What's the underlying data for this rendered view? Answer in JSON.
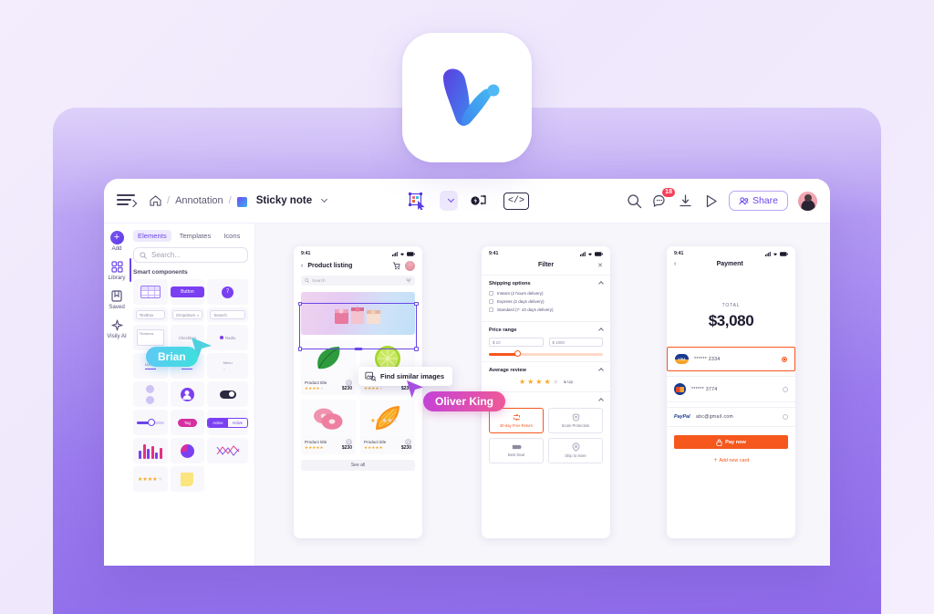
{
  "brand": {
    "name": "Visily",
    "logo_colors": [
      "#5b3fe0",
      "#3fa9f5",
      "#4fc3f7"
    ]
  },
  "theme": {
    "accent": "#6a46e8",
    "orange": "#f5571d",
    "magenta": "#d62fa0",
    "star": "#f9a826"
  },
  "topbar": {
    "menu_icon": "hamburger-icon",
    "breadcrumb": {
      "home_icon": "home-icon",
      "sep1": "/",
      "project": "Annotation",
      "sep2": "/",
      "page": "Sticky note",
      "page_icon": "sticky-note-icon",
      "chevron": "chevron-down-icon"
    },
    "center_tools": [
      {
        "name": "select-frame-tool",
        "icon": "frame-select-icon"
      },
      {
        "name": "tool-options-dropdown",
        "icon": "chevron-down-icon"
      },
      {
        "name": "ai-flow-tool",
        "icon": "ai-flow-icon"
      },
      {
        "name": "code-view-tool",
        "icon": "code-icon",
        "label": "</>"
      }
    ],
    "right_tools": [
      {
        "name": "search-icon",
        "label": ""
      },
      {
        "name": "comments-icon",
        "badge": "18"
      },
      {
        "name": "download-icon",
        "label": ""
      },
      {
        "name": "present-icon",
        "label": ""
      }
    ],
    "share_label": "Share",
    "share_icon": "people-icon",
    "avatar": "user-avatar"
  },
  "rail": {
    "items": [
      {
        "label": "Add",
        "icon": "plus-icon",
        "active": false
      },
      {
        "label": "Library",
        "icon": "library-icon",
        "active": true
      },
      {
        "label": "Saved",
        "icon": "saved-icon",
        "active": false
      },
      {
        "label": "Visily AI",
        "icon": "sparkle-icon",
        "active": false
      }
    ]
  },
  "panel": {
    "tabs": [
      {
        "label": "Elements",
        "active": true
      },
      {
        "label": "Templates",
        "active": false
      },
      {
        "label": "Icons",
        "active": false
      }
    ],
    "search_placeholder": "Search...",
    "search_icon": "search-icon",
    "section_title": "Smart components",
    "components": [
      {
        "name": "table-component",
        "label": ""
      },
      {
        "name": "button-component",
        "label": "Button"
      },
      {
        "name": "badge-component",
        "label": "7"
      },
      {
        "name": "textbox-component",
        "label": "Textbox"
      },
      {
        "name": "dropdown-component",
        "label": "Dropdown"
      },
      {
        "name": "search-component",
        "label": "Search"
      },
      {
        "name": "textarea-component",
        "label": "Textarea"
      },
      {
        "name": "checkbox-component",
        "label": "Checkbox"
      },
      {
        "name": "radio-component",
        "label": "Radio"
      },
      {
        "name": "menu-component",
        "label": "Menu"
      },
      {
        "name": "tabs-component",
        "label": "Menu"
      },
      {
        "name": "list-menu-component",
        "label": "Menu"
      },
      {
        "name": "avatar-list-component",
        "label": ""
      },
      {
        "name": "avatar-component",
        "label": ""
      },
      {
        "name": "toggle-component",
        "label": ""
      },
      {
        "name": "slider-component",
        "label": ""
      },
      {
        "name": "tag-component",
        "label": "Tag"
      },
      {
        "name": "segmented-control-component",
        "label": "Active"
      },
      {
        "name": "bar-chart-component",
        "label": ""
      },
      {
        "name": "pie-chart-component",
        "label": ""
      },
      {
        "name": "line-chart-component",
        "label": ""
      },
      {
        "name": "rating-component",
        "label": ""
      },
      {
        "name": "sticky-note-component",
        "label": ""
      }
    ]
  },
  "collaborators": [
    {
      "name": "Brian",
      "color": "#4fd1e0"
    },
    {
      "name": "Oliver King",
      "color": "#e2509e"
    }
  ],
  "tooltip": {
    "label": "Find similar images",
    "icon": "image-search-icon"
  },
  "phones": {
    "product_listing": {
      "status_time": "9:41",
      "title": "Product listing",
      "back_icon": "chevron-left-icon",
      "cart_icon": "cart-icon",
      "avatar": "user-avatar",
      "search_placeholder": "Search",
      "filter_icon": "filter-icon",
      "products": [
        {
          "title": "Product title",
          "price": "$230",
          "stars": 4,
          "image": "leaf"
        },
        {
          "title": "Product title",
          "price": "$230",
          "stars": 4,
          "image": "lime"
        },
        {
          "title": "Product title",
          "price": "$230",
          "stars": 5,
          "image": "donuts"
        },
        {
          "title": "Product title",
          "price": "$230",
          "stars": 4.5,
          "image": "orange"
        }
      ],
      "see_all": "See all",
      "floating_rating_stars": 2
    },
    "filter": {
      "status_time": "9:41",
      "title": "Filter",
      "close_icon": "close-icon",
      "sections": [
        {
          "title": "Shipping options",
          "options": [
            "Instant (2 hours delivery)",
            "Express (2 days delivery)",
            "Standard (7- 10 days delivery)"
          ]
        }
      ],
      "price_range": {
        "title": "Price range",
        "min": "$  10",
        "max": "$  1000"
      },
      "average_review": {
        "title": "Average review",
        "stars": 4,
        "suffix": "& Up"
      },
      "others": {
        "title": "Others",
        "items": [
          {
            "label": "30-day Free Return",
            "icon": "return-icon",
            "selected": true
          },
          {
            "label": "Scam Protection",
            "icon": "shield-icon",
            "selected": false
          },
          {
            "label": "Best Deal",
            "icon": "tag-icon",
            "selected": false
          },
          {
            "label": "Ship to store",
            "icon": "pin-icon",
            "selected": false
          }
        ]
      }
    },
    "payment": {
      "status_time": "9:41",
      "title": "Payment",
      "back_icon": "chevron-left-icon",
      "total_label": "TOTAL",
      "total_amount": "$3,080",
      "methods": [
        {
          "brand": "visa",
          "value": "****** 2334",
          "selected": true
        },
        {
          "brand": "mastercard",
          "value": "****** 3774",
          "selected": false
        },
        {
          "brand": "paypal",
          "value": "abc@gmail.com",
          "selected": false
        }
      ],
      "pay_button": "Pay now",
      "pay_icon": "lock-icon",
      "add_card": "Add new card",
      "add_icon": "plus-icon"
    }
  }
}
